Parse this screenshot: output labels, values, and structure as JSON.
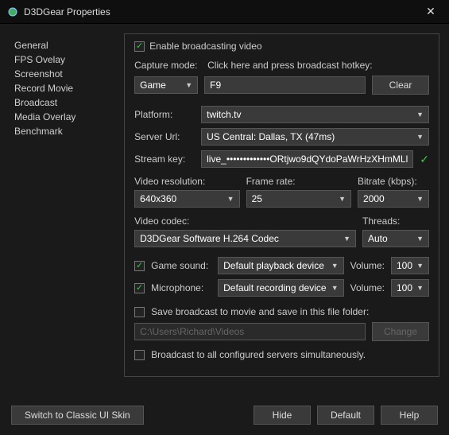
{
  "window": {
    "title": "D3DGear Properties"
  },
  "sidebar": {
    "items": [
      {
        "label": "General"
      },
      {
        "label": "FPS Ovelay"
      },
      {
        "label": "Screenshot"
      },
      {
        "label": "Record Movie"
      },
      {
        "label": "Broadcast"
      },
      {
        "label": "Media Overlay"
      },
      {
        "label": "Benchmark"
      }
    ]
  },
  "enable": {
    "label": "Enable broadcasting video"
  },
  "capture": {
    "mode_label": "Capture mode:",
    "mode_value": "Game",
    "hotkey_label": "Click here and press broadcast hotkey:",
    "hotkey_value": "F9",
    "clear": "Clear"
  },
  "platform": {
    "label": "Platform:",
    "value": "twitch.tv"
  },
  "server": {
    "label": "Server Url:",
    "value": "US Central: Dallas, TX    (47ms)"
  },
  "stream": {
    "label": "Stream key:",
    "value": "live_•••••••••••••ORtjwo9dQYdoPaWrHzXHmMLl"
  },
  "video": {
    "res_label": "Video resolution:",
    "res_value": "640x360",
    "fps_label": "Frame rate:",
    "fps_value": "25",
    "bitrate_label": "Bitrate (kbps):",
    "bitrate_value": "2000",
    "codec_label": "Video codec:",
    "codec_value": "D3DGear Software H.264 Codec",
    "threads_label": "Threads:",
    "threads_value": "Auto"
  },
  "audio": {
    "game_label": "Game sound:",
    "game_value": "Default playback device",
    "mic_label": "Microphone:",
    "mic_value": "Default recording device",
    "volume_label": "Volume:",
    "game_vol": "100",
    "mic_vol": "100"
  },
  "save": {
    "label": "Save broadcast to movie and save in this file folder:",
    "path": "C:\\Users\\Richard\\Videos",
    "change": "Change"
  },
  "multi": {
    "label": "Broadcast to all configured servers simultaneously."
  },
  "footer": {
    "skin": "Switch to Classic UI Skin",
    "hide": "Hide",
    "default": "Default",
    "help": "Help"
  }
}
